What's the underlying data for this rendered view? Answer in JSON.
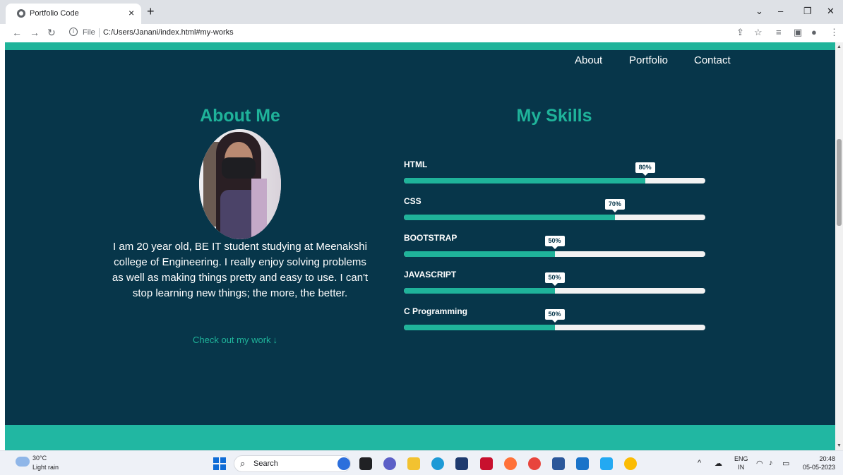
{
  "browser": {
    "tab_title": "Portfolio Code",
    "new_tab": "+",
    "close_tab": "×",
    "omnibox_scheme": "File",
    "url": "C:/Users/Janani/index.html#my-works"
  },
  "nav": {
    "items": [
      "About",
      "Portfolio",
      "Contact"
    ]
  },
  "about": {
    "title": "About Me",
    "text": "I am 20 year old, BE IT student studying at Meenakshi college of Engineering. I really enjoy solving problems as well as making things pretty and easy to use. I can't stop learning new things; the more, the better.",
    "link": "Check out my work",
    "link_arrow": "↓"
  },
  "skills": {
    "title": "My Skills",
    "items": [
      {
        "name": "HTML",
        "label": "80%",
        "fraction": 0.8
      },
      {
        "name": "CSS",
        "label": "70%",
        "fraction": 0.7
      },
      {
        "name": "BOOTSTRAP",
        "label": "50%",
        "fraction": 0.5
      },
      {
        "name": "JAVASCRIPT",
        "label": "50%",
        "fraction": 0.5
      },
      {
        "name": "C Programming",
        "label": "50%",
        "fraction": 0.5
      }
    ]
  },
  "colors": {
    "page_bg": "#07364a",
    "accent": "#1fb39a",
    "track": "#f2f2f2"
  },
  "taskbar": {
    "temp": "30°C",
    "weather": "Light rain",
    "search_placeholder": "Search",
    "lang_top": "ENG",
    "lang_bottom": "IN",
    "time": "20:48",
    "date": "05-05-2023"
  }
}
